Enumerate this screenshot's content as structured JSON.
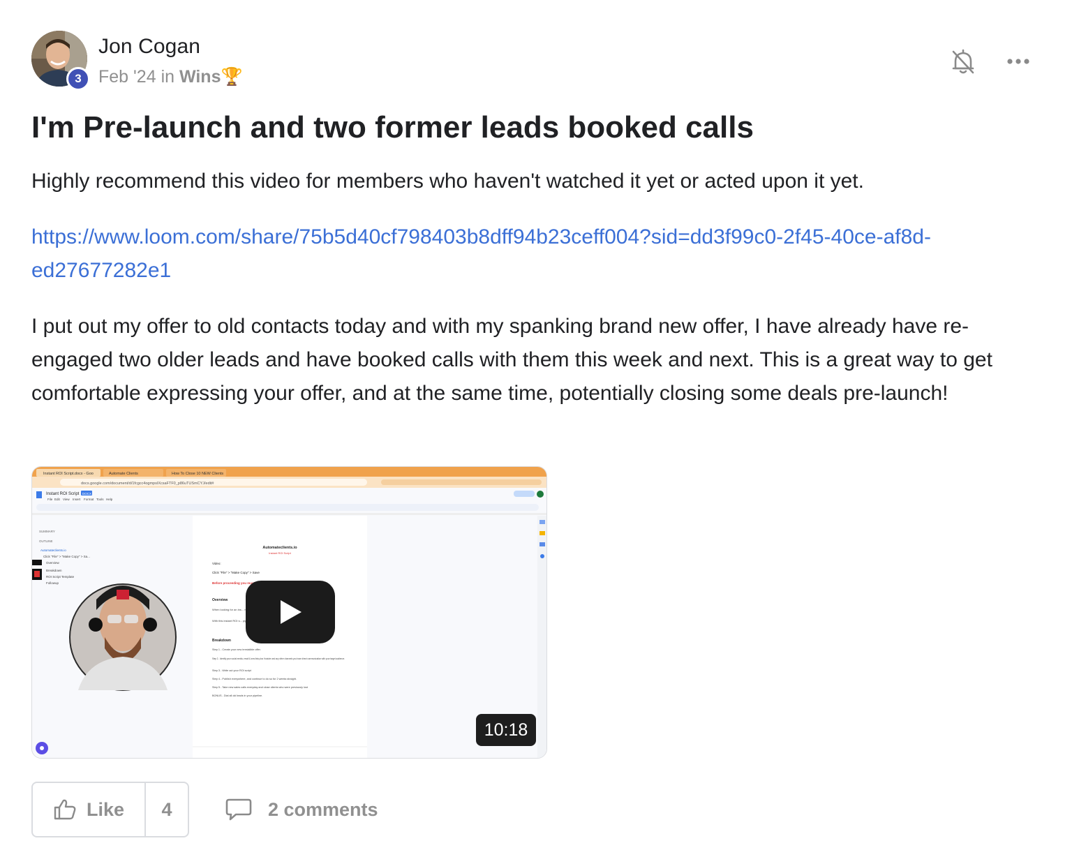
{
  "post": {
    "author": {
      "name": "Jon Cogan",
      "level": "3"
    },
    "meta": {
      "date": "Feb '24",
      "in": "in",
      "category": "Wins",
      "category_emoji": "🏆"
    },
    "title": "I'm Pre-launch and two former leads booked calls",
    "body": {
      "p1": "Highly recommend this video for members who haven't watched it yet or acted upon it yet.",
      "link": "https://www.loom.com/share/75b5d40cf798403b8dff94b23ceff004?sid=dd3f99c0-2f45-40ce-af8d-ed27677282e1",
      "p3": "I put out my offer to old contacts today and with my spanking brand new offer, I have already have re-engaged two older leads and have booked calls with them this week and next. This is a great way to get comfortable expressing your offer, and at the same time, potentially closing some deals pre-launch!"
    },
    "video": {
      "duration": "10:18",
      "browser_tabs": [
        "Instant ROI Script.docx - Goo",
        "Automate Clients",
        "How To Close 10 NEW Clients"
      ],
      "address_bar": "docs.google.com/document/d/1fcgcc4ogmpsIXcsaFTF0_p86uTUSmCYJ/edit#",
      "doc_name": "Instant ROI Script",
      "doc_badge": "DOCX",
      "menu": [
        "File",
        "Edit",
        "View",
        "Insert",
        "Format",
        "Tools",
        "Help"
      ],
      "outline": {
        "summary": "SUMMARY",
        "outline": "OUTLINE",
        "items": [
          "Automateclients.io",
          "Click \"File\" > \"Make Copy\" > Sa...",
          "Overview",
          "Breakdown",
          "ROI Script Template",
          "Followup"
        ]
      },
      "doc": {
        "heading": "Automateclients.io",
        "subheading": "Instant ROI Script",
        "video_label": "Video:",
        "copy_line": "Click \"File\" > \"Make Copy\" > Save",
        "warning": "Before proceeding you must ... your pipeline / CRM.",
        "overview": "Overview",
        "ov1": "When looking for an ins... n't have to do much work.",
        "ov2": "With this instant ROI s... pipeline of leads to flood your ca...",
        "breakdown": "Breakdown",
        "steps": [
          "Step 1 - Create your new irresistible offer.",
          "Step 2 - Identify your social media, email & sms lists plus Youtube and any other channels you have direct communication with your target audience.",
          "Step 3 - Write out your ROI script",
          "Step 4 - Publish everywhere, and continue to do so for 2 weeks straight.",
          "Step 5 - Take new sales calls everyday and close clients who were previously lost",
          "BONUS - Dial all old leads in your pipeline."
        ]
      }
    },
    "actions": {
      "like_label": "Like",
      "like_count": "4",
      "comments_label": "2 comments"
    }
  }
}
